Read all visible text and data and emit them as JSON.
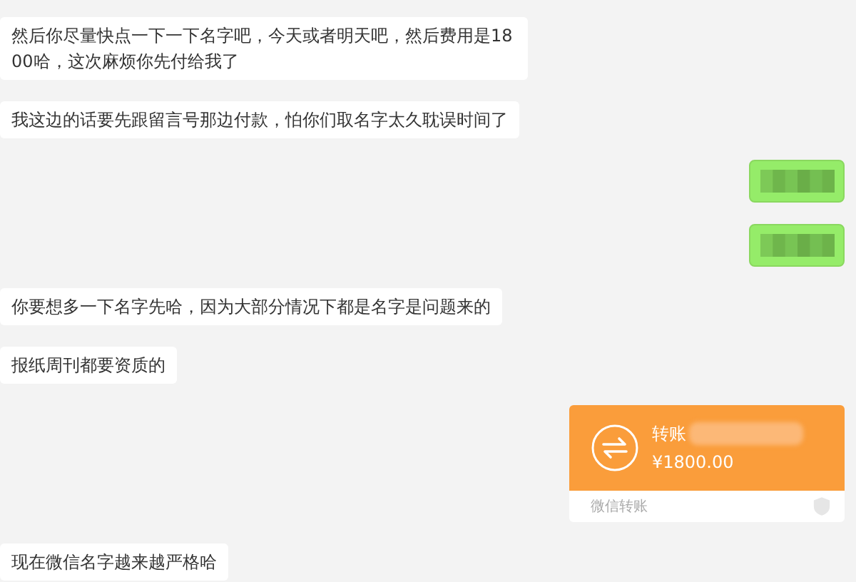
{
  "messages": [
    {
      "kind": "text",
      "outgoing": false,
      "text": "然后你尽量快点一下一下名字吧，今天或者明天吧，然后费用是1800哈，这次麻烦你先付给我了"
    },
    {
      "kind": "text",
      "outgoing": false,
      "text": "我这边的话要先跟留言号那边付款，怕你们取名字太久耽误时间了"
    },
    {
      "kind": "redacted",
      "outgoing": true
    },
    {
      "kind": "redacted",
      "outgoing": true
    },
    {
      "kind": "text",
      "outgoing": false,
      "text": "你要想多一下名字先哈，因为大部分情况下都是名字是问题来的"
    },
    {
      "kind": "text",
      "outgoing": false,
      "text": "报纸周刊都要资质的"
    },
    {
      "kind": "transfer",
      "outgoing": true,
      "title": "转账",
      "amount": "¥1800.00",
      "footer": "微信转账"
    },
    {
      "kind": "text",
      "outgoing": false,
      "text": "现在微信名字越来越严格哈"
    }
  ]
}
